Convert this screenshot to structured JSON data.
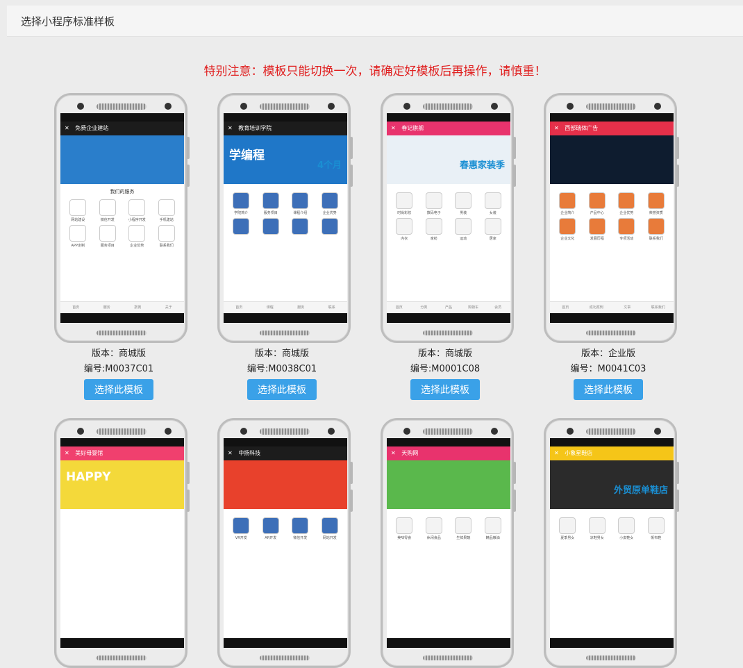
{
  "header": {
    "title": "选择小程序标准样板"
  },
  "notice": "特别注意：模板只能切换一次，请确定好模板后再操作，请慎重！",
  "choose_label": "选择此模板",
  "templates": [
    {
      "version": "版本：商城版",
      "code": "编号:M0037C01",
      "nav_title": "免费企业建站",
      "nav_color": "#1c1c1c",
      "hero_color": "#2a7ecb",
      "hero_text": "",
      "hero_sub": "",
      "section": "我们的服务",
      "icons": [
        "网站建设",
        "微信开发",
        "小程序开发",
        "手机建站",
        "APP定制",
        "服务项目",
        "企业优势",
        "联系我们"
      ],
      "icon_color": "#ffffff",
      "tabs": [
        "首页",
        "服务",
        "案例",
        "关于"
      ]
    },
    {
      "version": "版本：商城版",
      "code": "编号:M0038C01",
      "nav_title": "教育培训学院",
      "nav_color": "#1c1c1c",
      "hero_color": "#1f77c8",
      "hero_text": "学编程",
      "hero_sub": "4个月",
      "section": "",
      "icons": [
        "学院简介",
        "服务项目",
        "课程介绍",
        "企业优势",
        "",
        "",
        "",
        ""
      ],
      "icon_color": "#3d6fb8",
      "tabs": [
        "首页",
        "课程",
        "服务",
        "联系"
      ]
    },
    {
      "version": "版本：商城版",
      "code": "编号:M0001C08",
      "nav_title": "春记旗舰",
      "nav_color": "#e8336d",
      "hero_color": "#e9f0f6",
      "hero_text": "",
      "hero_sub": "春惠家装季",
      "section": "",
      "icons": [
        "时尚彩妆",
        "数码电子",
        "男装",
        "女装",
        "内衣",
        "家纺",
        "运动",
        "居家"
      ],
      "icon_color": "#f3f3f3",
      "tabs": [
        "首页",
        "分类",
        "产品",
        "购物车",
        "会员"
      ]
    },
    {
      "version": "版本：企业版",
      "code": "编号：M0041C03",
      "nav_title": "西部瑞体广告",
      "nav_color": "#e5304a",
      "hero_color": "#0e1c2f",
      "hero_text": "",
      "hero_sub": "",
      "section": "",
      "icons": [
        "企业简介",
        "产品中心",
        "企业优势",
        "荣誉资质",
        "企业文化",
        "发展历程",
        "专项活动",
        "联系我们"
      ],
      "icon_color": "#e87b3a",
      "tabs": [
        "首页",
        "成功案例",
        "文章",
        "联系我们"
      ]
    },
    {
      "version": "",
      "code": "",
      "nav_title": "美好母婴馆",
      "nav_color": "#f0406e",
      "hero_color": "#f4d93a",
      "hero_text": "HAPPY",
      "hero_sub": "",
      "section": "",
      "icons": [],
      "icon_color": "#ffffff",
      "tabs": []
    },
    {
      "version": "",
      "code": "",
      "nav_title": "中扬科技",
      "nav_color": "#1c1c1c",
      "hero_color": "#e8412c",
      "hero_text": "",
      "hero_sub": "",
      "section": "",
      "icons": [
        "VR开发",
        "AR开发",
        "微信开发",
        "网站开发"
      ],
      "icon_color": "#3d6fb8",
      "tabs": []
    },
    {
      "version": "",
      "code": "",
      "nav_title": "天购网",
      "nav_color": "#e8336d",
      "hero_color": "#5ab84c",
      "hero_text": "",
      "hero_sub": "",
      "section": "",
      "icons": [
        "美味零食",
        "休闲食品",
        "生鲜果蔬",
        "精品粮油"
      ],
      "icon_color": "#f3f3f3",
      "tabs": []
    },
    {
      "version": "",
      "code": "",
      "nav_title": "小象星鞋店",
      "nav_color": "#f5c518",
      "hero_color": "#2b2b2b",
      "hero_text": "",
      "hero_sub": "外贸原单鞋店",
      "section": "",
      "icons": [
        "夏季男女",
        "凉鞋男女",
        "小皮鞋女",
        "帆布鞋"
      ],
      "icon_color": "#f3f3f3",
      "tabs": []
    }
  ]
}
